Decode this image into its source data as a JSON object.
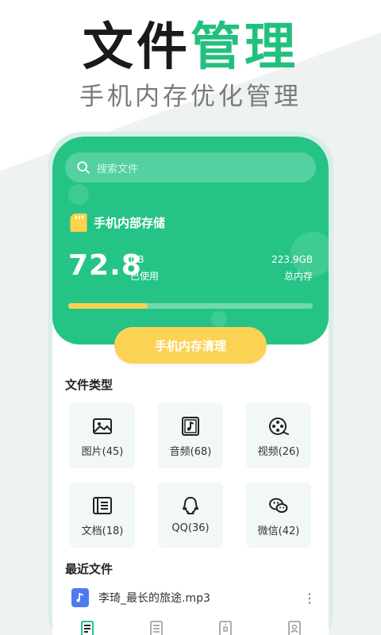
{
  "promo": {
    "headline_dark": "文件",
    "headline_green": "管理",
    "subline": "手机内存优化管理"
  },
  "search": {
    "placeholder": "搜索文件"
  },
  "storage": {
    "title": "手机内部存储",
    "used_value": "72.8",
    "used_unit": "GB",
    "used_label": "已使用",
    "total_value": "223.9GB",
    "total_label": "总内存",
    "usage_fraction": 0.325
  },
  "clean_button": {
    "label": "手机内存清理"
  },
  "file_types": {
    "title": "文件类型",
    "items": [
      {
        "label": "图片(45)",
        "icon": "image-icon"
      },
      {
        "label": "音频(68)",
        "icon": "music-note-icon"
      },
      {
        "label": "视频(26)",
        "icon": "film-reel-icon"
      },
      {
        "label": "文档(18)",
        "icon": "document-icon"
      },
      {
        "label": "QQ(36)",
        "icon": "qq-icon"
      },
      {
        "label": "微信(42)",
        "icon": "wechat-icon"
      }
    ]
  },
  "recent": {
    "title": "最近文件",
    "items": [
      {
        "name": "李琦_最长的旅途.mp3",
        "icon": "music-file-icon"
      }
    ]
  },
  "nav": {
    "items": [
      {
        "icon": "file-list-icon"
      },
      {
        "icon": "document-icon"
      },
      {
        "icon": "archive-icon"
      },
      {
        "icon": "contact-icon"
      }
    ]
  },
  "colors": {
    "accent": "#25c486",
    "headline_green": "#22c07f",
    "button": "#fcd254",
    "progress": "#ffd24d",
    "tile_bg": "#f1f8f5"
  }
}
